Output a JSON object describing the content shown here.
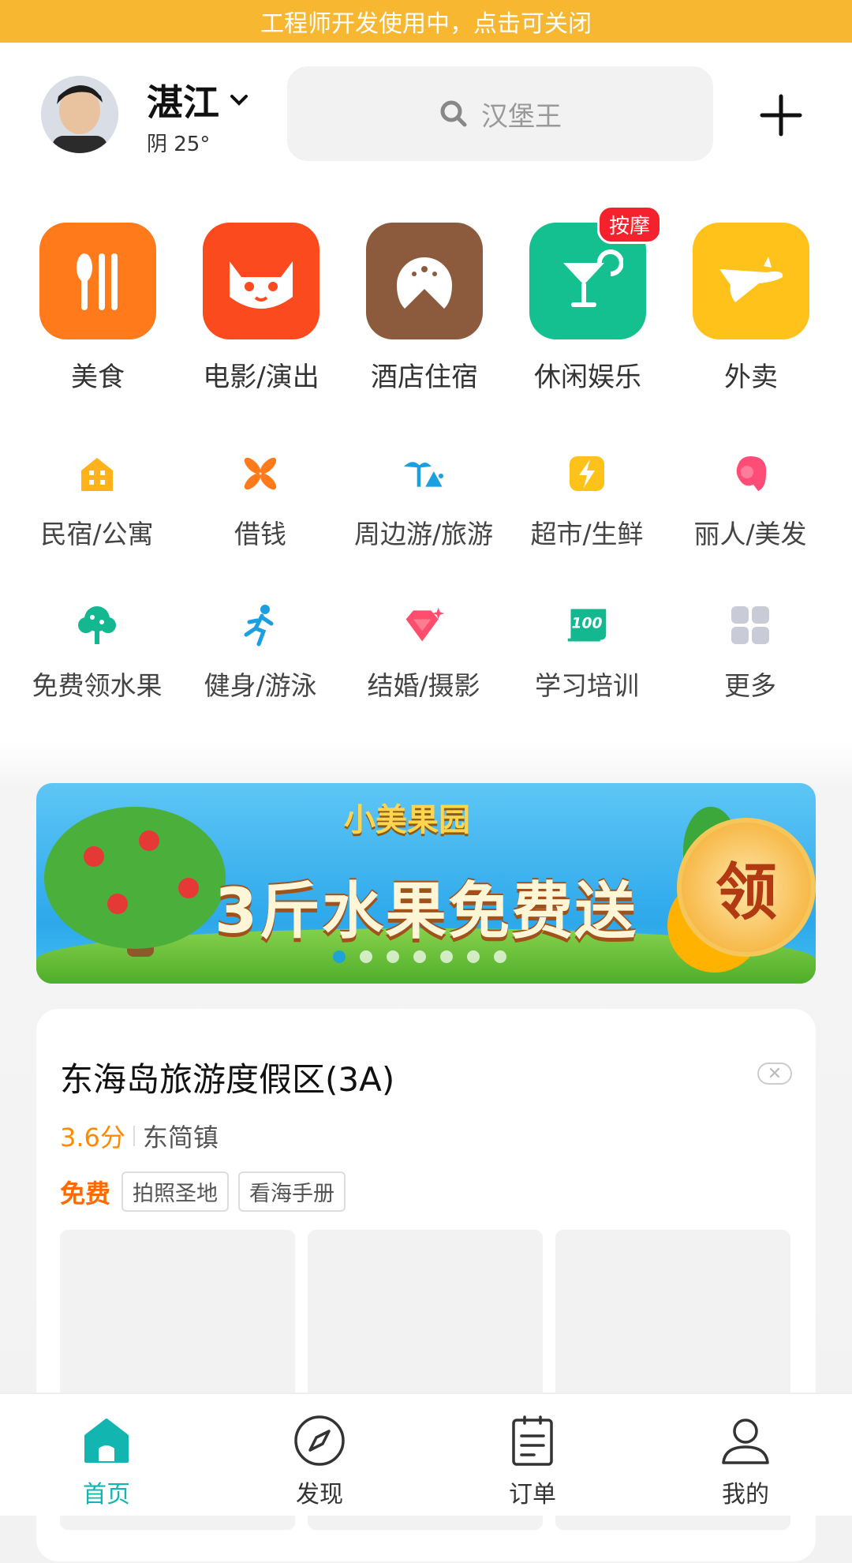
{
  "dev_banner": {
    "text": "工程师开发使用中，点击可关闭"
  },
  "header": {
    "city": "湛江",
    "weather": "阴 25°",
    "search_placeholder": "汉堡王"
  },
  "big_categories": [
    {
      "label": "美食",
      "icon": "fork-spoon-icon",
      "color": "#FF7A1A"
    },
    {
      "label": "电影/演出",
      "icon": "cat-face-icon",
      "color": "#FA4A1E"
    },
    {
      "label": "酒店住宿",
      "icon": "hotel-dome-icon",
      "color": "#8C5A3C"
    },
    {
      "label": "休闲娱乐",
      "icon": "cocktail-icon",
      "color": "#14C08F",
      "badge": "按摩"
    },
    {
      "label": "外卖",
      "icon": "kangaroo-icon",
      "color": "#FFC21A"
    }
  ],
  "small_categories": [
    {
      "label": "民宿/公寓",
      "icon": "house-icon"
    },
    {
      "label": "借钱",
      "icon": "pinwheel-icon"
    },
    {
      "label": "周边游/旅游",
      "icon": "palm-tree-icon"
    },
    {
      "label": "超市/生鲜",
      "icon": "lightning-icon"
    },
    {
      "label": "丽人/美发",
      "icon": "woman-head-icon"
    },
    {
      "label": "免费领水果",
      "icon": "fruit-tree-icon"
    },
    {
      "label": "健身/游泳",
      "icon": "running-man-icon"
    },
    {
      "label": "结婚/摄影",
      "icon": "diamond-icon"
    },
    {
      "label": "学习培训",
      "icon": "score-100-icon"
    },
    {
      "label": "更多",
      "icon": "grid-more-icon"
    }
  ],
  "promo_banner": {
    "subtitle": "小美果园",
    "headline": "3斤水果免费送",
    "button": "领",
    "dot_count": 7,
    "active_dot": 0
  },
  "card": {
    "title": "东海岛旅游度假区(3A)",
    "rating": "3.6分",
    "location": "东简镇",
    "free_tag": "免费",
    "tags": [
      "拍照圣地",
      "看海手册"
    ]
  },
  "bottom_nav": [
    {
      "label": "首页",
      "icon": "home-icon",
      "active": true
    },
    {
      "label": "发现",
      "icon": "compass-icon",
      "active": false
    },
    {
      "label": "订单",
      "icon": "order-clipboard-icon",
      "active": false
    },
    {
      "label": "我的",
      "icon": "user-icon",
      "active": false
    }
  ]
}
